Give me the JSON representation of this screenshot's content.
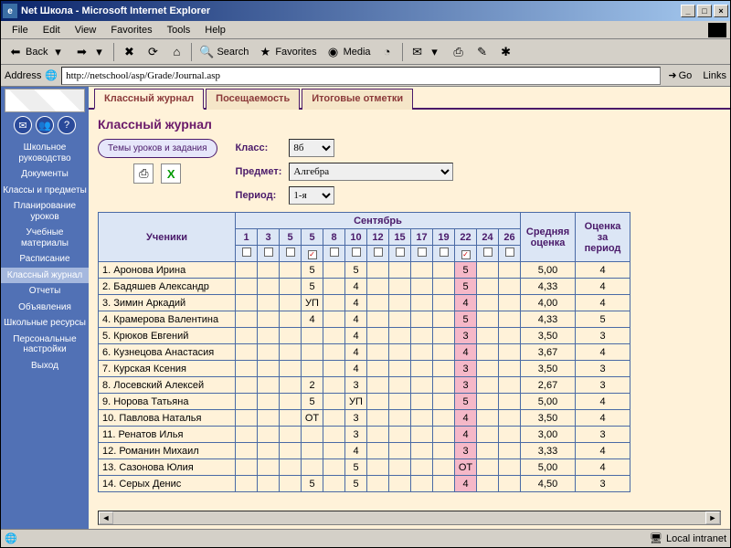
{
  "window": {
    "title": "Net Школа - Microsoft Internet Explorer"
  },
  "menu": {
    "file": "File",
    "edit": "Edit",
    "view": "View",
    "favorites": "Favorites",
    "tools": "Tools",
    "help": "Help"
  },
  "toolbar": {
    "back": "Back",
    "search": "Search",
    "favorites": "Favorites",
    "media": "Media"
  },
  "address": {
    "label": "Address",
    "url": "http://netschool/asp/Grade/Journal.asp",
    "go": "Go",
    "links": "Links"
  },
  "sidebar": {
    "items": [
      {
        "label": "Школьное руководство"
      },
      {
        "label": "Документы"
      },
      {
        "label": "Классы и предметы"
      },
      {
        "label": "Планирование уроков"
      },
      {
        "label": "Учебные материалы"
      },
      {
        "label": "Расписание"
      },
      {
        "label": "Классный журнал"
      },
      {
        "label": "Отчеты"
      },
      {
        "label": "Объявления"
      },
      {
        "label": "Школьные ресурсы"
      },
      {
        "label": "Персональные настройки"
      },
      {
        "label": "Выход"
      }
    ],
    "active_index": 6
  },
  "tabs": {
    "items": [
      {
        "label": "Классный журнал"
      },
      {
        "label": "Посещаемость"
      },
      {
        "label": "Итоговые отметки"
      }
    ],
    "active_index": 0
  },
  "page": {
    "title": "Классный журнал",
    "theme_btn": "Темы уроков и задания",
    "class_label": "Класс:",
    "class_value": "8б",
    "subject_label": "Предмет:",
    "subject_value": "Алгебра",
    "period_label": "Период:",
    "period_value": "1-я"
  },
  "headers": {
    "students": "Ученики",
    "month": "Сентябрь",
    "avg": "Средняя оценка",
    "period_grade": "Оценка за период"
  },
  "dates": [
    "1",
    "3",
    "5",
    "5",
    "8",
    "10",
    "12",
    "15",
    "17",
    "19",
    "22",
    "24",
    "26"
  ],
  "checked_cols": [
    3,
    10
  ],
  "hl_col": 10,
  "students": [
    {
      "n": "1",
      "name": "Аронова Ирина",
      "marks": {
        "3": "5",
        "5": "5",
        "10": "5"
      },
      "avg": "5,00",
      "pg": "4"
    },
    {
      "n": "2",
      "name": "Бадяшев Александр",
      "marks": {
        "3": "5",
        "5": "4",
        "10": "5"
      },
      "avg": "4,33",
      "pg": "4"
    },
    {
      "n": "3",
      "name": "Зимин Аркадий",
      "marks": {
        "3": "УП",
        "5": "4",
        "10": "4"
      },
      "avg": "4,00",
      "pg": "4"
    },
    {
      "n": "4",
      "name": "Крамерова Валентина",
      "marks": {
        "3": "4",
        "5": "4",
        "10": "5"
      },
      "avg": "4,33",
      "pg": "5"
    },
    {
      "n": "5",
      "name": "Крюков Евгений",
      "marks": {
        "5": "4",
        "10": "3"
      },
      "avg": "3,50",
      "pg": "3"
    },
    {
      "n": "6",
      "name": "Кузнецова Анастасия",
      "marks": {
        "5": "4",
        "10": "4"
      },
      "avg": "3,67",
      "pg": "4"
    },
    {
      "n": "7",
      "name": "Курская Ксения",
      "marks": {
        "5": "4",
        "10": "3"
      },
      "avg": "3,50",
      "pg": "3"
    },
    {
      "n": "8",
      "name": "Лосевский Алексей",
      "marks": {
        "3": "2",
        "5": "3",
        "10": "3"
      },
      "avg": "2,67",
      "pg": "3"
    },
    {
      "n": "9",
      "name": "Норова Татьяна",
      "marks": {
        "3": "5",
        "5": "УП",
        "10": "5"
      },
      "avg": "5,00",
      "pg": "4"
    },
    {
      "n": "10",
      "name": "Павлова Наталья",
      "marks": {
        "3": "ОТ",
        "5": "3",
        "10": "4"
      },
      "avg": "3,50",
      "pg": "4"
    },
    {
      "n": "11",
      "name": "Ренатов Илья",
      "marks": {
        "5": "3",
        "10": "4"
      },
      "avg": "3,00",
      "pg": "3"
    },
    {
      "n": "12",
      "name": "Романин Михаил",
      "marks": {
        "5": "4",
        "10": "3"
      },
      "avg": "3,33",
      "pg": "4"
    },
    {
      "n": "13",
      "name": "Сазонова Юлия",
      "marks": {
        "5": "5",
        "10": "ОТ"
      },
      "avg": "5,00",
      "pg": "4"
    },
    {
      "n": "14",
      "name": "Серых Денис",
      "marks": {
        "3": "5",
        "5": "5",
        "10": "4"
      },
      "avg": "4,50",
      "pg": "3"
    }
  ],
  "status": {
    "zone": "Local intranet"
  }
}
